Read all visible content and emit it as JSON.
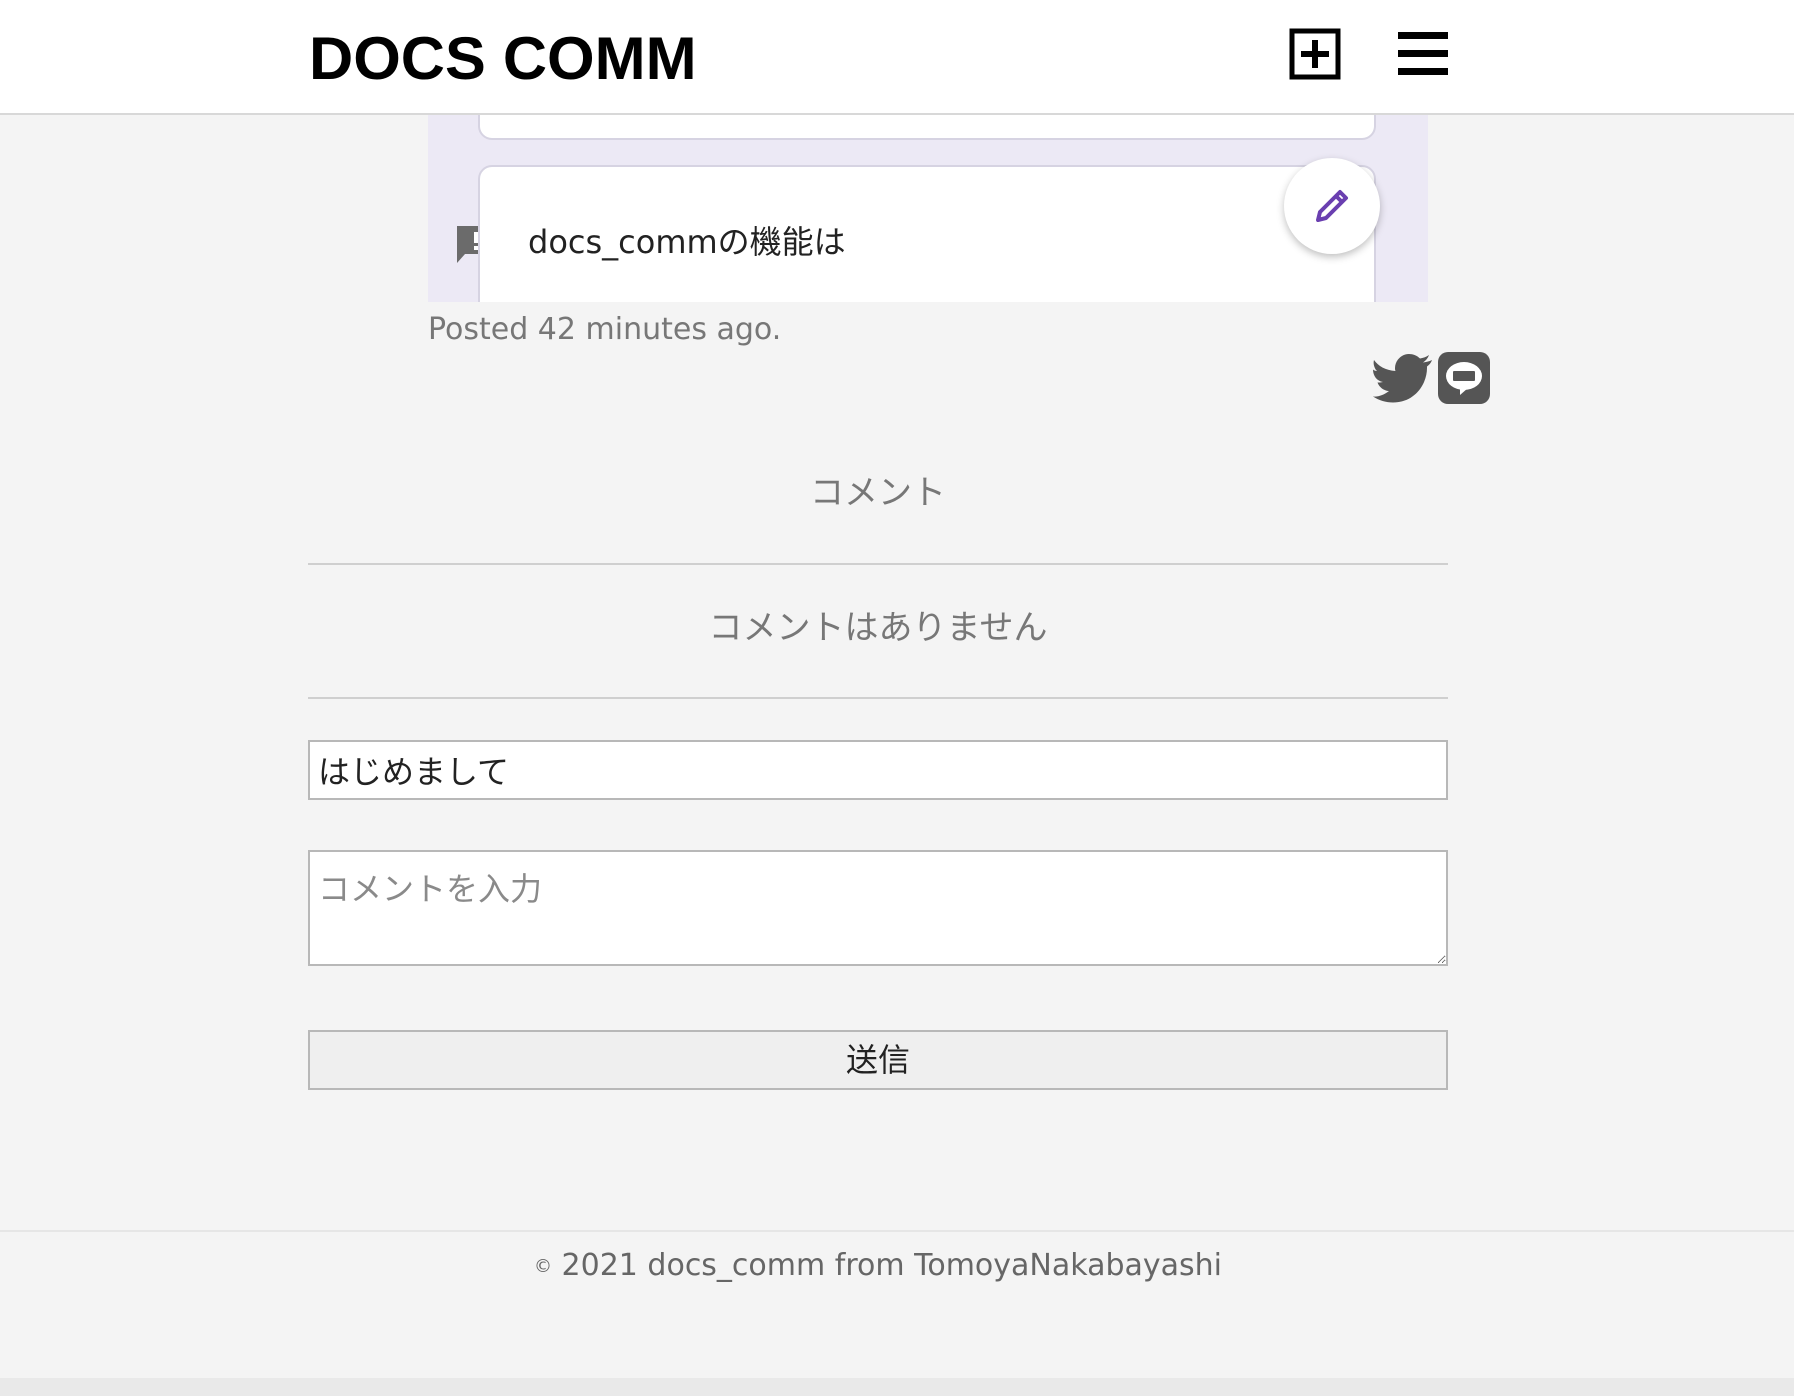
{
  "header": {
    "logo": "DOCS COMM",
    "add_icon": "plus-square-icon",
    "menu_icon": "hamburger-menu-icon"
  },
  "doc_preview": {
    "card_text": "docs_commの機能は",
    "flag_icon": "comment-alert-icon",
    "edit_icon": "pencil-icon",
    "accent_color": "#6a3fb0",
    "background_color": "#ece9f5"
  },
  "post": {
    "posted_text": "Posted 42 minutes ago.",
    "share_icons": [
      "twitter-icon",
      "line-icon"
    ]
  },
  "comments": {
    "title": "コメント",
    "empty_text": "コメントはありません"
  },
  "form": {
    "title_value": "はじめまして",
    "comment_placeholder": "コメントを入力",
    "submit_label": "送信"
  },
  "footer": {
    "copyright_symbol": "©",
    "text": "2021 docs_comm from TomoyaNakabayashi"
  }
}
